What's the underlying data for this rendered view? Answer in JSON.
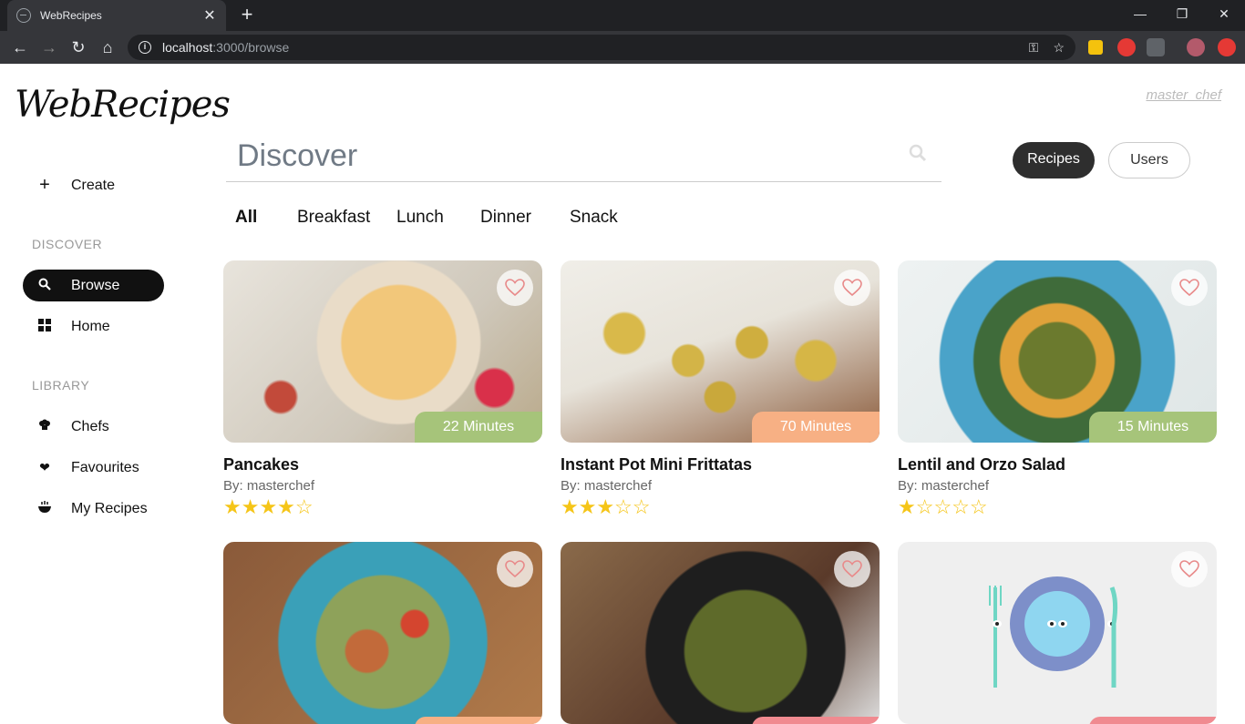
{
  "browser": {
    "tab_title": "WebRecipes",
    "url_host": "localhost",
    "url_path": ":3000/browse"
  },
  "app": {
    "logo": "WebRecipes",
    "username": "master_chef"
  },
  "sidebar": {
    "create": "Create",
    "discover_head": "DISCOVER",
    "browse": "Browse",
    "home": "Home",
    "library_head": "LIBRARY",
    "chefs": "Chefs",
    "favourites": "Favourites",
    "my_recipes": "My Recipes"
  },
  "search": {
    "placeholder": "Discover"
  },
  "toggle": {
    "recipes": "Recipes",
    "users": "Users"
  },
  "categories": [
    "All",
    "Breakfast",
    "Lunch",
    "Dinner",
    "Snack"
  ],
  "colors": {
    "green_badge": "#a6c47a",
    "orange_badge": "#f7b084",
    "pink_badge": "#f08a90",
    "star": "#f5c518",
    "heart": "#e88a8a"
  },
  "recipes": [
    {
      "name": "Pancakes",
      "author": "By: masterchef",
      "time": "22 Minutes",
      "stars": "★★★★☆"
    },
    {
      "name": "Instant Pot Mini Frittatas",
      "author": "By: masterchef",
      "time": "70 Minutes",
      "stars": "★★★☆☆"
    },
    {
      "name": "Lentil and Orzo Salad",
      "author": "By: masterchef",
      "time": "15 Minutes",
      "stars": "★☆☆☆☆"
    }
  ]
}
